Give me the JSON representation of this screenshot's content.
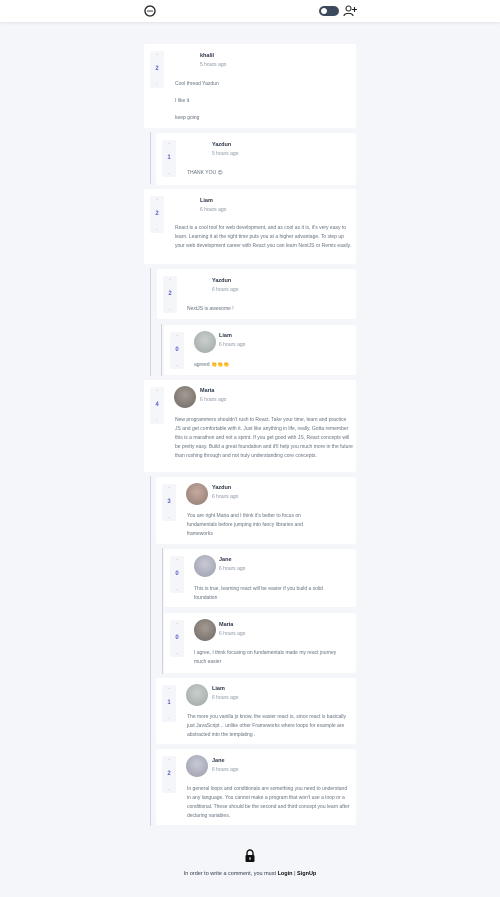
{
  "header": {
    "logo_icon": "chat-bubble-icon",
    "theme_toggle_icon": "toggle-switch-icon",
    "add_user_icon": "add-user-icon"
  },
  "comments": [
    {
      "author": "khalil",
      "time": "5 hours ago",
      "votes": "2",
      "paragraphs": [
        "Cool thread Yazdun",
        "I like it",
        "keep going"
      ]
    },
    {
      "author": "Yazdun",
      "time": "5 hours ago",
      "votes": "1",
      "text": "THANK YOU 😍"
    },
    {
      "author": "Liam",
      "time": "6 hours ago",
      "votes": "2",
      "text": "React is a cool tool for web development, and as cool as it is, it's very easy to learn. Learning it at the right time puts you at a higher advantage. To step up your web development career with React you can learn NextJS or Remix easily."
    },
    {
      "author": "Yazdun",
      "time": "6 hours ago",
      "votes": "2",
      "text": "NextJS is awesome !"
    },
    {
      "author": "Liam",
      "time": "6 hours ago",
      "votes": "0",
      "text": "agreed 👏👏👏"
    },
    {
      "author": "Maria",
      "time": "6 hours ago",
      "votes": "4",
      "text": "New programmers shouldn't rush to React. Take your time, learn and practice JS and get comfortable with it. Just like anything in life, really. Gotta remember this is a marathon and not a sprint. If you get good with JS, React concepts will be pretty easy. Build a great foundation and it'll help you much more in the future than rushing through and not truly understanding core concepts."
    },
    {
      "author": "Yazdun",
      "time": "6 hours ago",
      "votes": "3",
      "text": "You are right Maria and I think it's better to focus on fundamentals before jumping into fancy libraries and frameworks"
    },
    {
      "author": "Jane",
      "time": "6 hours ago",
      "votes": "0",
      "text": "This is true, learning react will be easier if you build a solid foundation"
    },
    {
      "author": "Maria",
      "time": "6 hours ago",
      "votes": "0",
      "text": "I agree, I think focusing on fundamentals made my react journey much easier"
    },
    {
      "author": "Liam",
      "time": "6 hours ago",
      "votes": "1",
      "text": "The more you vanilla js know, the easier react is, since react is basically just JavaScript .. unlike other Frameworks where loops for example are abstracted into the templating ."
    },
    {
      "author": "Jane",
      "time": "6 hours ago",
      "votes": "2",
      "text": "In general loops and conditionals are something you need to understand in any language. You cannot make a program that won't use a loop or a conditional. These should be the second and third concept you learn after declaring variables."
    }
  ],
  "footer": {
    "prefix": "In order to write a comment, you must",
    "login": "Login",
    "separator": "|",
    "signup": "SignUp"
  },
  "colors": {
    "accent": "#5b5fc7",
    "background": "#f5f6fa",
    "card": "#ffffff"
  }
}
